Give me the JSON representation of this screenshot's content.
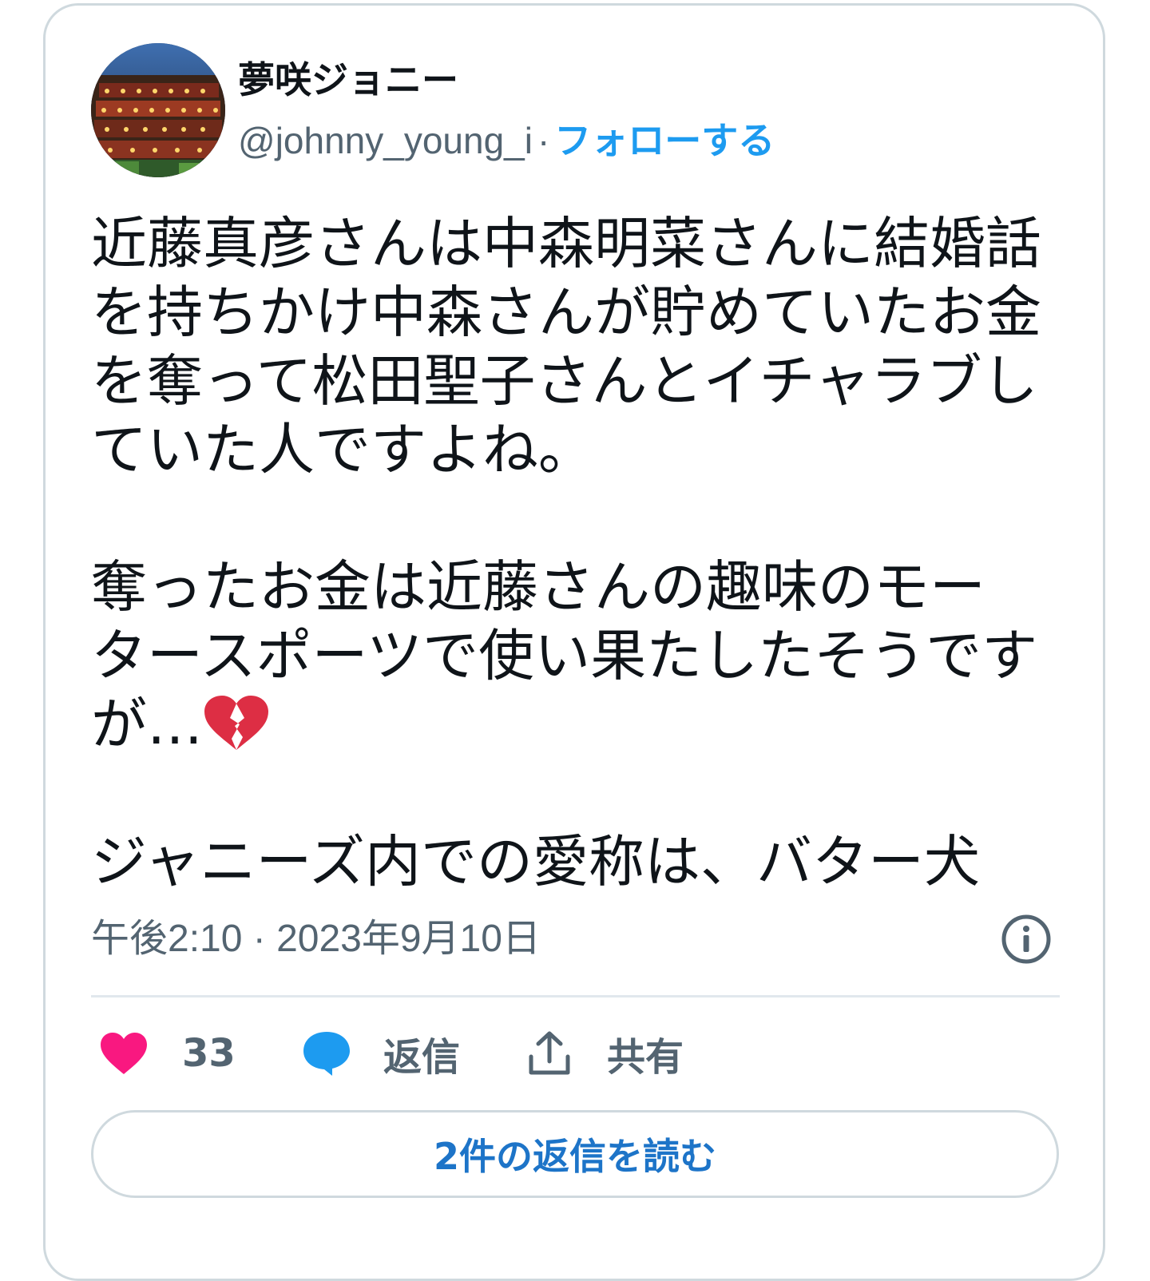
{
  "author": {
    "display_name": "夢咲ジョニー",
    "handle": "@johnny_young_i",
    "separator": "·",
    "follow_label": "フォローする"
  },
  "tweet": {
    "text_before_emoji": "近藤真彦さんは中森明菜さんに結婚話\nを持ちかけ中森さんが貯めていたお金\nを奪って松田聖子さんとイチャラブし\nていた人ですよね。\n\n奪ったお金は近藤さんの趣味のモー\nタースポーツで使い果たしたそうです\nが…",
    "emoji": "broken-heart-icon",
    "text_after_emoji": "\n\nジャニーズ内での愛称は、バター犬",
    "timestamp": "午後2:10 · 2023年9月10日"
  },
  "actions": {
    "like_count": "33",
    "reply_label": "返信",
    "share_label": "共有"
  },
  "read_replies_label": "2件の返信を読む",
  "colors": {
    "link_blue": "#1d9bf0",
    "heart_pink": "#f91880",
    "secondary_text": "#536471",
    "border": "#cfd9de"
  }
}
